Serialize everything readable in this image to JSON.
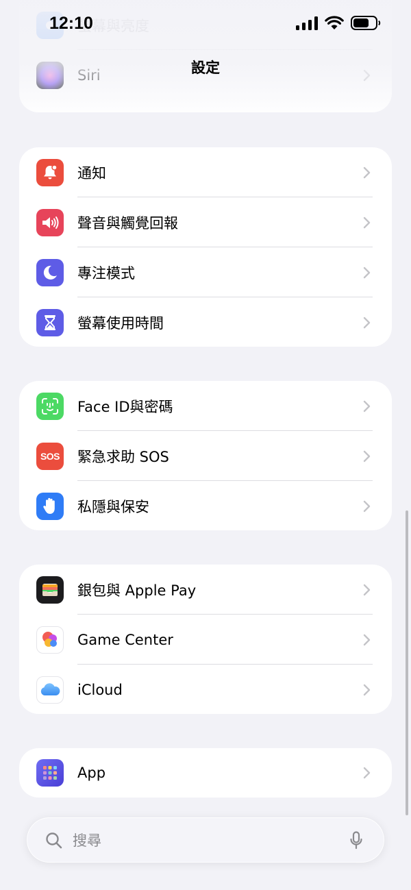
{
  "status_bar": {
    "time": "12:10"
  },
  "nav": {
    "title": "設定"
  },
  "top_group": [
    {
      "label": "螢幕與亮度",
      "icon": "display-icon"
    },
    {
      "label": "Siri",
      "icon": "siri-icon"
    }
  ],
  "group_1": [
    {
      "label": "通知",
      "icon": "bell-icon",
      "color": "#eb4d3d"
    },
    {
      "label": "聲音與觸覺回報",
      "icon": "speaker-icon",
      "color": "#e7445a"
    },
    {
      "label": "專注模式",
      "icon": "moon-icon",
      "color": "#5e5ce6"
    },
    {
      "label": "螢幕使用時間",
      "icon": "hourglass-icon",
      "color": "#5e5ce6"
    }
  ],
  "group_2": [
    {
      "label": "Face ID與密碼",
      "icon": "faceid-icon",
      "color": "#4cd964"
    },
    {
      "label": "緊急求助 SOS",
      "icon": "sos-icon",
      "icon_text": "SOS",
      "color": "#eb4d3d"
    },
    {
      "label": "私隱與保安",
      "icon": "hand-icon",
      "color": "#2f7cf6"
    }
  ],
  "group_3": [
    {
      "label": "銀包與 Apple Pay",
      "icon": "wallet-icon",
      "color": "#1c1c1e"
    },
    {
      "label": "Game Center",
      "icon": "game-center-icon",
      "color": "#ffffff"
    },
    {
      "label": "iCloud",
      "icon": "icloud-icon",
      "color": "#ffffff"
    }
  ],
  "group_4": [
    {
      "label": "App",
      "icon": "apps-icon",
      "color": "#5e5ce6"
    }
  ],
  "search": {
    "placeholder": "搜尋"
  }
}
